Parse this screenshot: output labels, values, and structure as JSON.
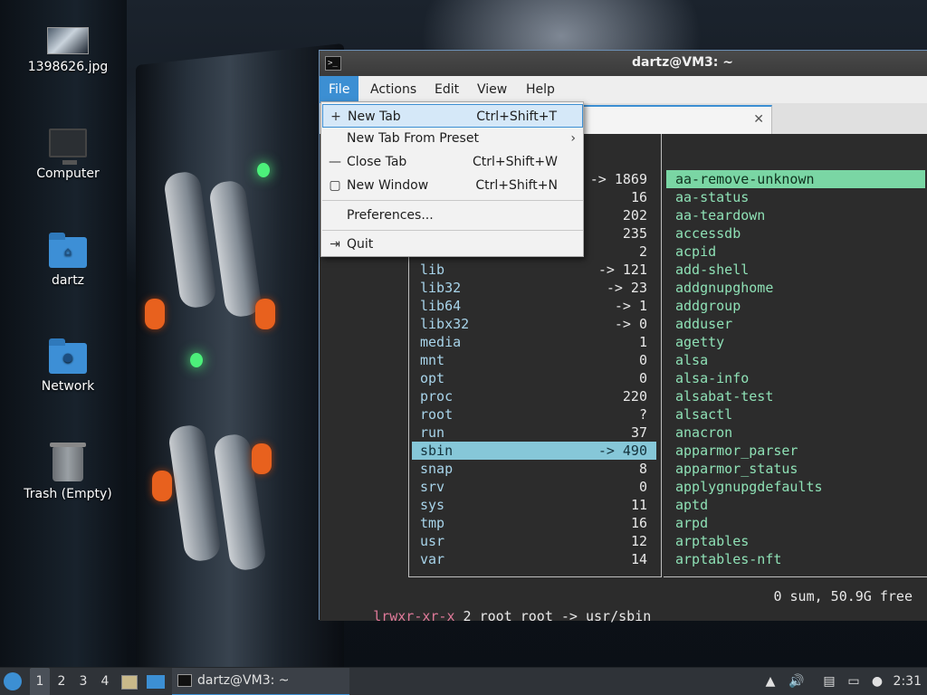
{
  "desktop": {
    "icons": [
      {
        "label": "1398626.jpg",
        "icon": "image-file-icon"
      },
      {
        "label": "Computer",
        "icon": "computer-icon"
      },
      {
        "label": "dartz",
        "icon": "home-folder-icon"
      },
      {
        "label": "Network",
        "icon": "network-folder-icon"
      },
      {
        "label": "Trash (Empty)",
        "icon": "trash-icon"
      }
    ]
  },
  "window": {
    "title": "dartz@VM3: ~",
    "menubar": [
      "File",
      "Actions",
      "Edit",
      "View",
      "Help"
    ],
    "active_menu": "File",
    "tab_close_glyph": "✕"
  },
  "file_menu": {
    "items": [
      {
        "label": "New Tab",
        "shortcut": "Ctrl+Shift+T",
        "icon": "plus-icon"
      },
      {
        "label": "New Tab From Preset",
        "submenu_glyph": "›"
      },
      {
        "label": "Close Tab",
        "shortcut": "Ctrl+Shift+W",
        "icon": "minus-icon"
      },
      {
        "label": "New Window",
        "shortcut": "Ctrl+Shift+N",
        "icon": "window-icon"
      },
      {
        "label": "Preferences..."
      },
      {
        "label": "Quit",
        "icon": "quit-icon"
      }
    ]
  },
  "terminal": {
    "left_pane": [
      {
        "name": "",
        "count": "-> 1869"
      },
      {
        "name": "",
        "count": "16"
      },
      {
        "name": "",
        "count": "202"
      },
      {
        "name": "",
        "count": "235"
      },
      {
        "name": "",
        "count": "2"
      },
      {
        "name": "lib",
        "count": "-> 121"
      },
      {
        "name": "lib32",
        "count": "-> 23"
      },
      {
        "name": "lib64",
        "count": "-> 1"
      },
      {
        "name": "libx32",
        "count": "-> 0"
      },
      {
        "name": "media",
        "count": "1"
      },
      {
        "name": "mnt",
        "count": "0"
      },
      {
        "name": "opt",
        "count": "0"
      },
      {
        "name": "proc",
        "count": "220"
      },
      {
        "name": "root",
        "count": "?"
      },
      {
        "name": "run",
        "count": "37"
      },
      {
        "name": "sbin",
        "count": "-> 490"
      },
      {
        "name": "snap",
        "count": "8"
      },
      {
        "name": "srv",
        "count": "0"
      },
      {
        "name": "sys",
        "count": "11"
      },
      {
        "name": "tmp",
        "count": "16"
      },
      {
        "name": "usr",
        "count": "12"
      },
      {
        "name": "var",
        "count": "14"
      }
    ],
    "left_selected": "sbin",
    "right_pane": [
      "aa-remove-unknown",
      "aa-status",
      "aa-teardown",
      "accessdb",
      "acpid",
      "add-shell",
      "addgnupghome",
      "addgroup",
      "adduser",
      "agetty",
      "alsa",
      "alsa-info",
      "alsabat-test",
      "alsactl",
      "anacron",
      "apparmor_parser",
      "apparmor_status",
      "applygnupgdefaults",
      "aptd",
      "arpd",
      "arptables",
      "arptables-nft"
    ],
    "right_selected": "aa-remove-unknown",
    "status": {
      "permissions": "lrwxr-xr-x",
      "info": " 2 root root -> usr/sbin",
      "free": "0 sum, 50.9G free"
    }
  },
  "taskbar": {
    "workspaces": [
      "1",
      "2",
      "3",
      "4"
    ],
    "active_workspace": "1",
    "task_label": "dartz@VM3: ~",
    "clock": "2:31"
  }
}
